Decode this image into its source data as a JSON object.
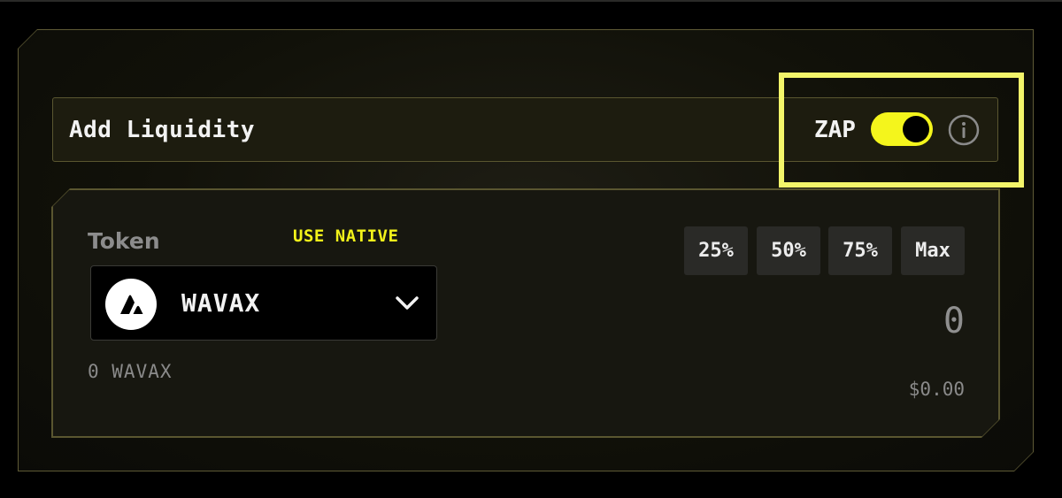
{
  "header": {
    "title": "Add Liquidity",
    "zap_label": "ZAP",
    "zap_enabled": true
  },
  "token_panel": {
    "label": "Token",
    "use_native": "USE NATIVE",
    "selected_token": "WAVAX",
    "balance": "0 WAVAX",
    "percent_buttons": [
      "25%",
      "50%",
      "75%",
      "Max"
    ],
    "amount": "0",
    "usd_value": "$0.00"
  },
  "colors": {
    "accent": "#f4f51c",
    "highlight": "#f3f56a"
  }
}
